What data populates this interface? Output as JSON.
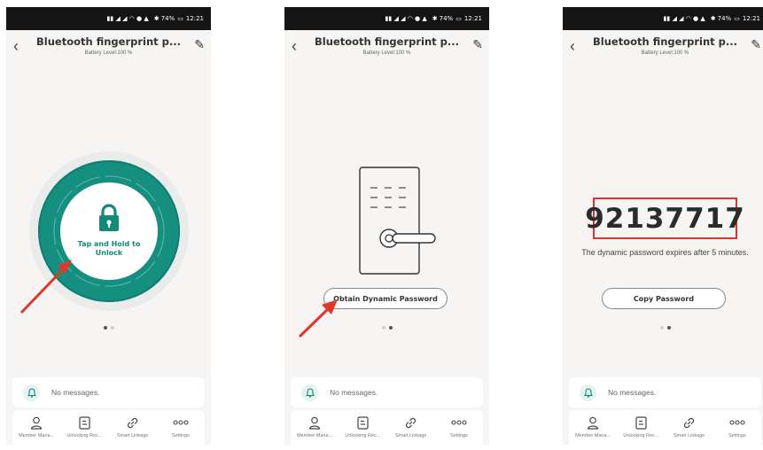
{
  "status_bar": {
    "battery": "74%",
    "time": "12:21"
  },
  "header": {
    "title": "Bluetooth fingerprint p...",
    "battery_level": "Battery Level:100 %"
  },
  "screen1": {
    "unlock_label": "Tap and Hold to Unlock"
  },
  "screen2": {
    "obtain_button": "Obtain Dynamic Password"
  },
  "screen3": {
    "password": "92137717",
    "expiry_note": "The dynamic password expires after 5 minutes.",
    "copy_button": "Copy Password"
  },
  "messages": {
    "text": "No messages."
  },
  "nav": {
    "items": [
      {
        "label": "Member Mana...",
        "icon": "person-icon"
      },
      {
        "label": "Unlocking Rec...",
        "icon": "record-icon"
      },
      {
        "label": "Smart Linkage",
        "icon": "link-icon"
      },
      {
        "label": "Settings",
        "icon": "more-icon"
      }
    ]
  },
  "colors": {
    "accent": "#159080",
    "highlight": "#d9352c",
    "arrow": "#e2362b"
  }
}
